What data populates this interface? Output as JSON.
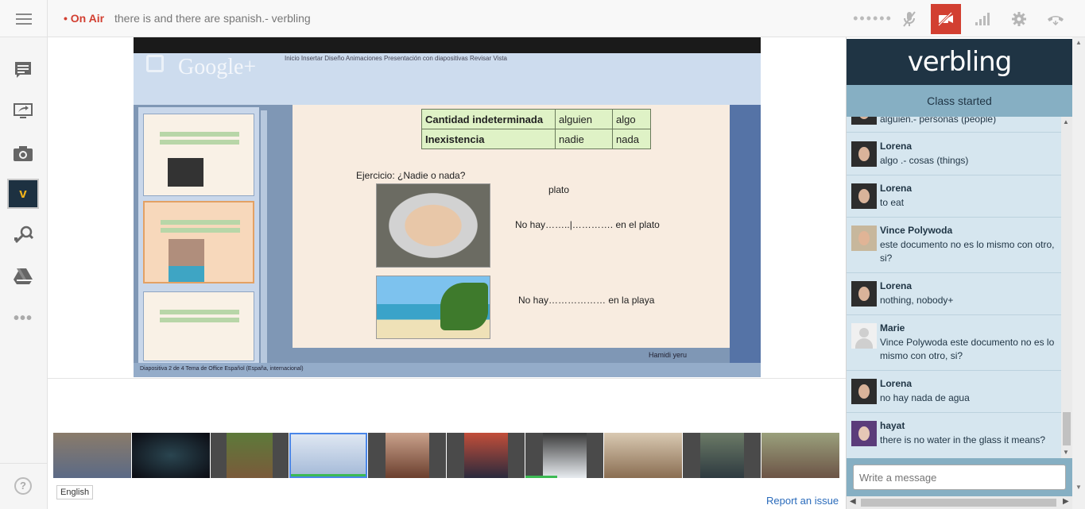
{
  "header": {
    "on_air": "• On Air",
    "title": "there is and there are spanish.- verbling"
  },
  "toolbar": {
    "left_items": [
      "chat-icon",
      "screenshare-icon",
      "camera-icon",
      "verbling-app-icon",
      "effects-icon",
      "drive-icon",
      "more-icon"
    ],
    "help": "?"
  },
  "slide": {
    "watermark": "Google+",
    "ribbon_tabs": "Inicio   Insertar   Diseño   Animaciones   Presentación con diapositivas   Revisar   Vista",
    "table": [
      [
        "Cantidad indeterminada",
        "alguien",
        "algo"
      ],
      [
        "Inexistencia",
        "nadie",
        "nada"
      ]
    ],
    "exercise": "Ejercicio: ¿Nadie o nada?",
    "label_plato": "plato",
    "line1": "No hay……..|…………. en el plato",
    "line2": "No hay……………… en la playa",
    "footer": "Hamidi yeru",
    "status": "Diapositiva 2 de 4    Tema de Office    Español (España, internacional)"
  },
  "filmstrip": {
    "count": 10,
    "selected": 3,
    "green_under": [
      3,
      6
    ]
  },
  "language": "English",
  "report_link": "Report an issue",
  "panel": {
    "brand": "verbling",
    "status": "Class started",
    "partial_top": "alguien.- personas (people)",
    "messages": [
      {
        "name": "Lorena",
        "text": "algo .- cosas (things)",
        "avatar": "lorena"
      },
      {
        "name": "Lorena",
        "text": "to eat",
        "avatar": "lorena"
      },
      {
        "name": "Vince Polywoda",
        "text": "este documento no es lo mismo con otro, si?",
        "avatar": "vince"
      },
      {
        "name": "Lorena",
        "text": "nothing, nobody+",
        "avatar": "lorena"
      },
      {
        "name": "Marie",
        "text": "Vince Polywoda este documento no es lo mismo con otro, si?",
        "avatar": "marie"
      },
      {
        "name": "Lorena",
        "text": "no hay nada de agua",
        "avatar": "lorena"
      },
      {
        "name": "hayat",
        "text": "there is no water in the glass it means?",
        "avatar": "hayat"
      }
    ],
    "compose_placeholder": "Write a message"
  },
  "colors": {
    "on_air": "#d23f31",
    "brand_bg": "#1f3444",
    "panel_accent": "#86afc3",
    "chat_bg": "#d6e6ef",
    "link": "#2a6bbb"
  }
}
